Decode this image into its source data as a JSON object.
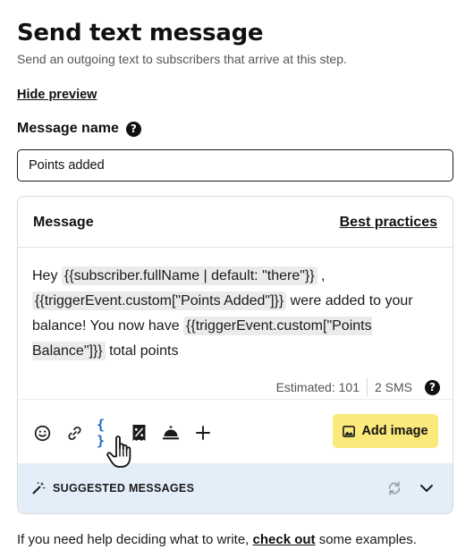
{
  "header": {
    "title": "Send text message",
    "subtitle": "Send an outgoing text to subscribers that arrive at this step."
  },
  "hide_preview": "Hide preview",
  "message_name": {
    "label": "Message name",
    "help": "?",
    "value": "Points added"
  },
  "message": {
    "title": "Message",
    "best_practices": "Best practices",
    "segments": [
      "Hey ",
      "{{subscriber.fullName | default: \"there\"}}",
      " ,",
      "{{triggerEvent.custom[\"Points Added\"]}}",
      " were added to your balance! You now have ",
      "{{triggerEvent.custom[\"Points Balance\"]}}",
      " total points"
    ],
    "estimated": "Estimated: 101",
    "sms_count": "2 SMS",
    "estimate_help": "?"
  },
  "toolbar": {
    "icons": [
      "emoji-icon",
      "link-icon",
      "variable-braces-icon",
      "discount-icon",
      "concierge-bell-icon",
      "plus-icon"
    ],
    "braces_glyph": "{ }",
    "add_image": "Add image",
    "accent_color": "#2163c7",
    "button_color": "#fbe97c"
  },
  "suggested": {
    "label": "SUGGESTED MESSAGES",
    "background": "#e3eef9"
  },
  "footer": {
    "prefix": "If you need help deciding what to write, ",
    "link": "check out",
    "suffix": " some examples."
  }
}
